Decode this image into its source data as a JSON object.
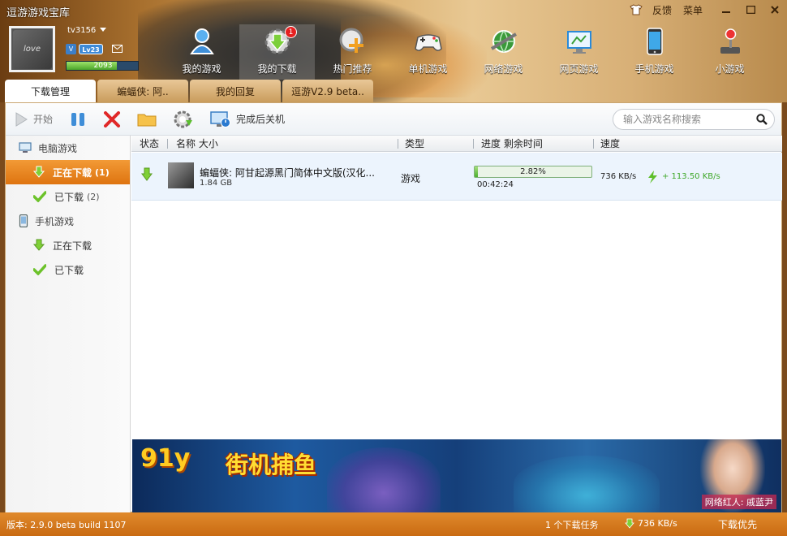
{
  "app": {
    "title": "逗游游戏宝库"
  },
  "topbar": {
    "feedback": "反馈",
    "menu": "菜单"
  },
  "user": {
    "avatar_text": "love",
    "name": "tv3156",
    "vip": "V",
    "level": "Lv23",
    "xp": "2093",
    "xp_fraction": 0.7
  },
  "nav": {
    "items": [
      {
        "label": "我的游戏"
      },
      {
        "label": "我的下载",
        "badge": "1"
      },
      {
        "label": "热门推荐"
      },
      {
        "label": "单机游戏"
      },
      {
        "label": "网络游戏"
      },
      {
        "label": "网页游戏"
      },
      {
        "label": "手机游戏"
      },
      {
        "label": "小游戏"
      }
    ]
  },
  "tabs": [
    {
      "label": "下载管理"
    },
    {
      "label": "蝙蝠侠: 阿.."
    },
    {
      "label": "我的回复"
    },
    {
      "label": "逗游V2.9 beta.."
    }
  ],
  "toolbar": {
    "start": "开始",
    "shutdown": "完成后关机",
    "search_placeholder": "输入游戏名称搜索"
  },
  "sidebar": {
    "pc_group": "电脑游戏",
    "pc_downloading": "正在下载",
    "pc_downloading_count": "(1)",
    "pc_downloaded": "已下载",
    "pc_downloaded_count": "(2)",
    "mobile_group": "手机游戏",
    "mobile_downloading": "正在下载",
    "mobile_downloaded": "已下载"
  },
  "table": {
    "col_status": "状态",
    "col_name": "名称 大小",
    "col_type": "类型",
    "col_progress": "进度 剩余时间",
    "col_speed": "速度",
    "rows": [
      {
        "name": "蝙蝠侠: 阿甘起源黑门简体中文版(汉化...",
        "size": "1.84 GB",
        "type": "游戏",
        "progress_text": "2.82%",
        "progress": 0.0282,
        "remaining": "00:42:24",
        "speed": "736 KB/s",
        "boost": "+ 113.50 KB/s"
      }
    ]
  },
  "ad": {
    "logo": "91y",
    "title": "街机捕鱼",
    "caption": "网络红人: 戚蓝尹"
  },
  "statusbar": {
    "version": "版本: 2.9.0 beta build 1107",
    "tasks": "1 个下载任务",
    "speed": "736 KB/s",
    "priority": "下载优先"
  },
  "colors": {
    "accent": "#de7410",
    "progress": "#4bb02e",
    "badge": "#e62020"
  }
}
